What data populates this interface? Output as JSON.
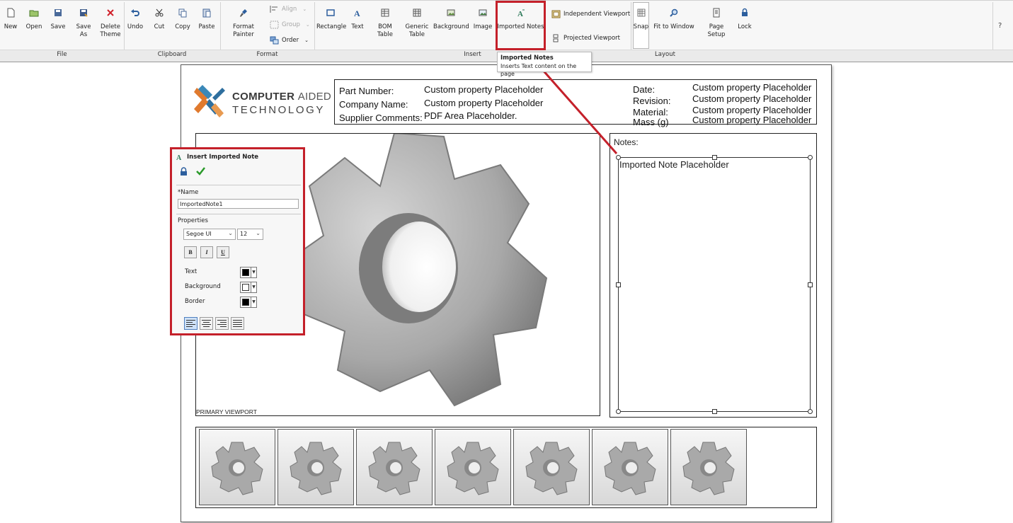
{
  "ribbon": {
    "groups": {
      "file": "File",
      "clipboard": "Clipboard",
      "format": "Format",
      "insert": "Insert",
      "layout": "Layout"
    },
    "file": {
      "new": "New",
      "open": "Open",
      "save": "Save",
      "save_as": "Save As",
      "delete_theme_1": "Delete",
      "delete_theme_2": "Theme"
    },
    "clipboard": {
      "undo": "Undo",
      "cut": "Cut",
      "copy": "Copy",
      "paste": "Paste"
    },
    "format": {
      "format_painter": "Format Painter",
      "align": "Align",
      "group": "Group",
      "order": "Order"
    },
    "insert": {
      "rectangle": "Rectangle",
      "text": "Text",
      "bom_table": "BOM Table",
      "generic_table_1": "Generic",
      "generic_table_2": "Table",
      "background": "Background",
      "image": "Image",
      "imported_notes": "Imported Notes",
      "independent_viewport": "Independent Viewport",
      "projected_viewport": "Projected Viewport"
    },
    "layout": {
      "snap": "Snap",
      "fit_to_window": "Fit to Window",
      "page_setup": "Page Setup",
      "lock": "Lock"
    },
    "help": "?"
  },
  "tooltip": {
    "title": "Imported Notes",
    "description": "Inserts Text content on the page"
  },
  "page": {
    "logo": {
      "line1_bold": "COMPUTER",
      "line1_light": "AIDED",
      "line2": "TECHNOLOGY"
    },
    "title_block": {
      "part_number_label": "Part Number:",
      "part_number_value": "Custom property Placeholder",
      "company_name_label": "Company Name:",
      "company_name_value": "Custom property Placeholder",
      "supplier_comments_label": "Supplier Comments:",
      "supplier_comments_value": "PDF Area Placeholder.",
      "date_label": "Date:",
      "date_value": "Custom property Placeholder",
      "revision_label": "Revision:",
      "revision_value": "Custom property Placeholder",
      "material_label": "Material:",
      "material_value": "Custom property Placeholder",
      "mass_label": "Mass (g)",
      "mass_value": "Custom property Placeholder"
    },
    "primary_viewport_label": "PRIMARY VIEWPORT",
    "notes": {
      "title": "Notes:",
      "placeholder": "Imported Note Placeholder"
    }
  },
  "dialog": {
    "title": "Insert Imported Note",
    "name_label": "*Name",
    "name_value": "ImportedNote1",
    "properties_label": "Properties",
    "font_family": "Segoe UI",
    "font_size": "12",
    "bold": "B",
    "italic": "I",
    "underline": "U",
    "text_label": "Text",
    "background_label": "Background",
    "border_label": "Border"
  },
  "colors": {
    "highlight": "#c4202a",
    "logo_orange": "#e07a2e",
    "logo_blue": "#2e6f9e"
  }
}
